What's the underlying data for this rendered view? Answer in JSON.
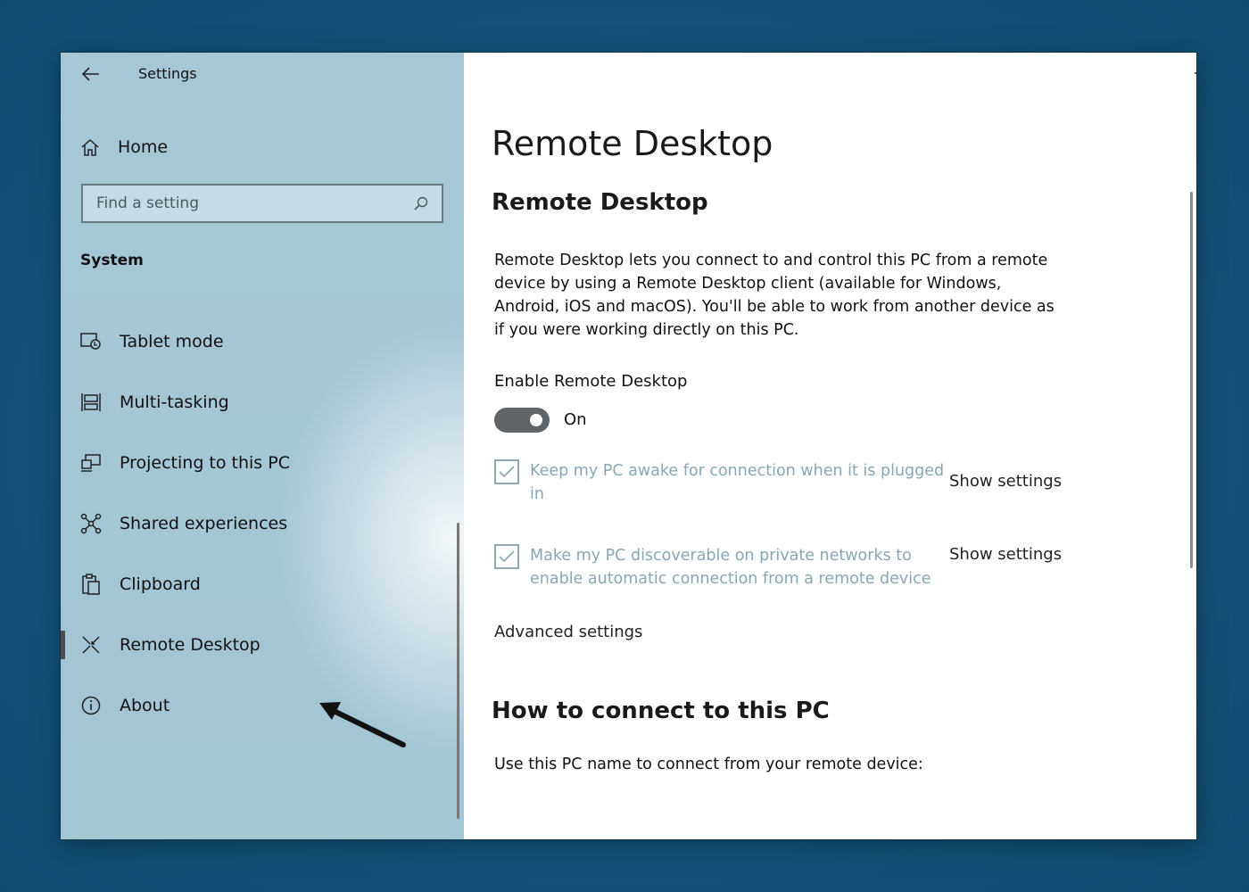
{
  "window": {
    "app_title": "Settings",
    "controls": [
      "minimize-icon",
      "maximize-icon",
      "close-icon"
    ]
  },
  "sidebar": {
    "home_label": "Home",
    "search": {
      "placeholder": "Find a setting",
      "value": ""
    },
    "section": "System",
    "items": [
      {
        "label": "Tablet mode",
        "icon": "tablet-mode-icon",
        "active": false
      },
      {
        "label": "Multi-tasking",
        "icon": "multitasking-icon",
        "active": false
      },
      {
        "label": "Projecting to this PC",
        "icon": "projecting-icon",
        "active": false
      },
      {
        "label": "Shared experiences",
        "icon": "shared-experiences-icon",
        "active": false
      },
      {
        "label": "Clipboard",
        "icon": "clipboard-icon",
        "active": false
      },
      {
        "label": "Remote Desktop",
        "icon": "remote-desktop-icon",
        "active": true
      },
      {
        "label": "About",
        "icon": "info-icon",
        "active": false
      }
    ]
  },
  "main": {
    "page_title": "Remote Desktop",
    "section_title": "Remote Desktop",
    "description": "Remote Desktop lets you connect to and control this PC from a remote device by using a Remote Desktop client (available for Windows, Android, iOS and macOS). You'll be able to work from another device as if you were working directly on this PC.",
    "enable_label": "Enable Remote Desktop",
    "toggle": {
      "state": "On",
      "on": true
    },
    "options": [
      {
        "text": "Keep my PC awake for connection when it is plugged in",
        "checked": true,
        "link": "Show settings"
      },
      {
        "text": "Make my PC discoverable on private networks to enable automatic connection from a remote device",
        "checked": true,
        "link": "Show settings"
      }
    ],
    "advanced_link": "Advanced settings",
    "howto_title": "How to connect to this PC",
    "howto_text": "Use this PC name to connect from your remote device:"
  },
  "colors": {
    "sidebar_bg": "#a6c8d6",
    "desktop_bg": "#14557b",
    "toggle_on": "#5f6468",
    "disabled_text": "#8aa6b3"
  }
}
